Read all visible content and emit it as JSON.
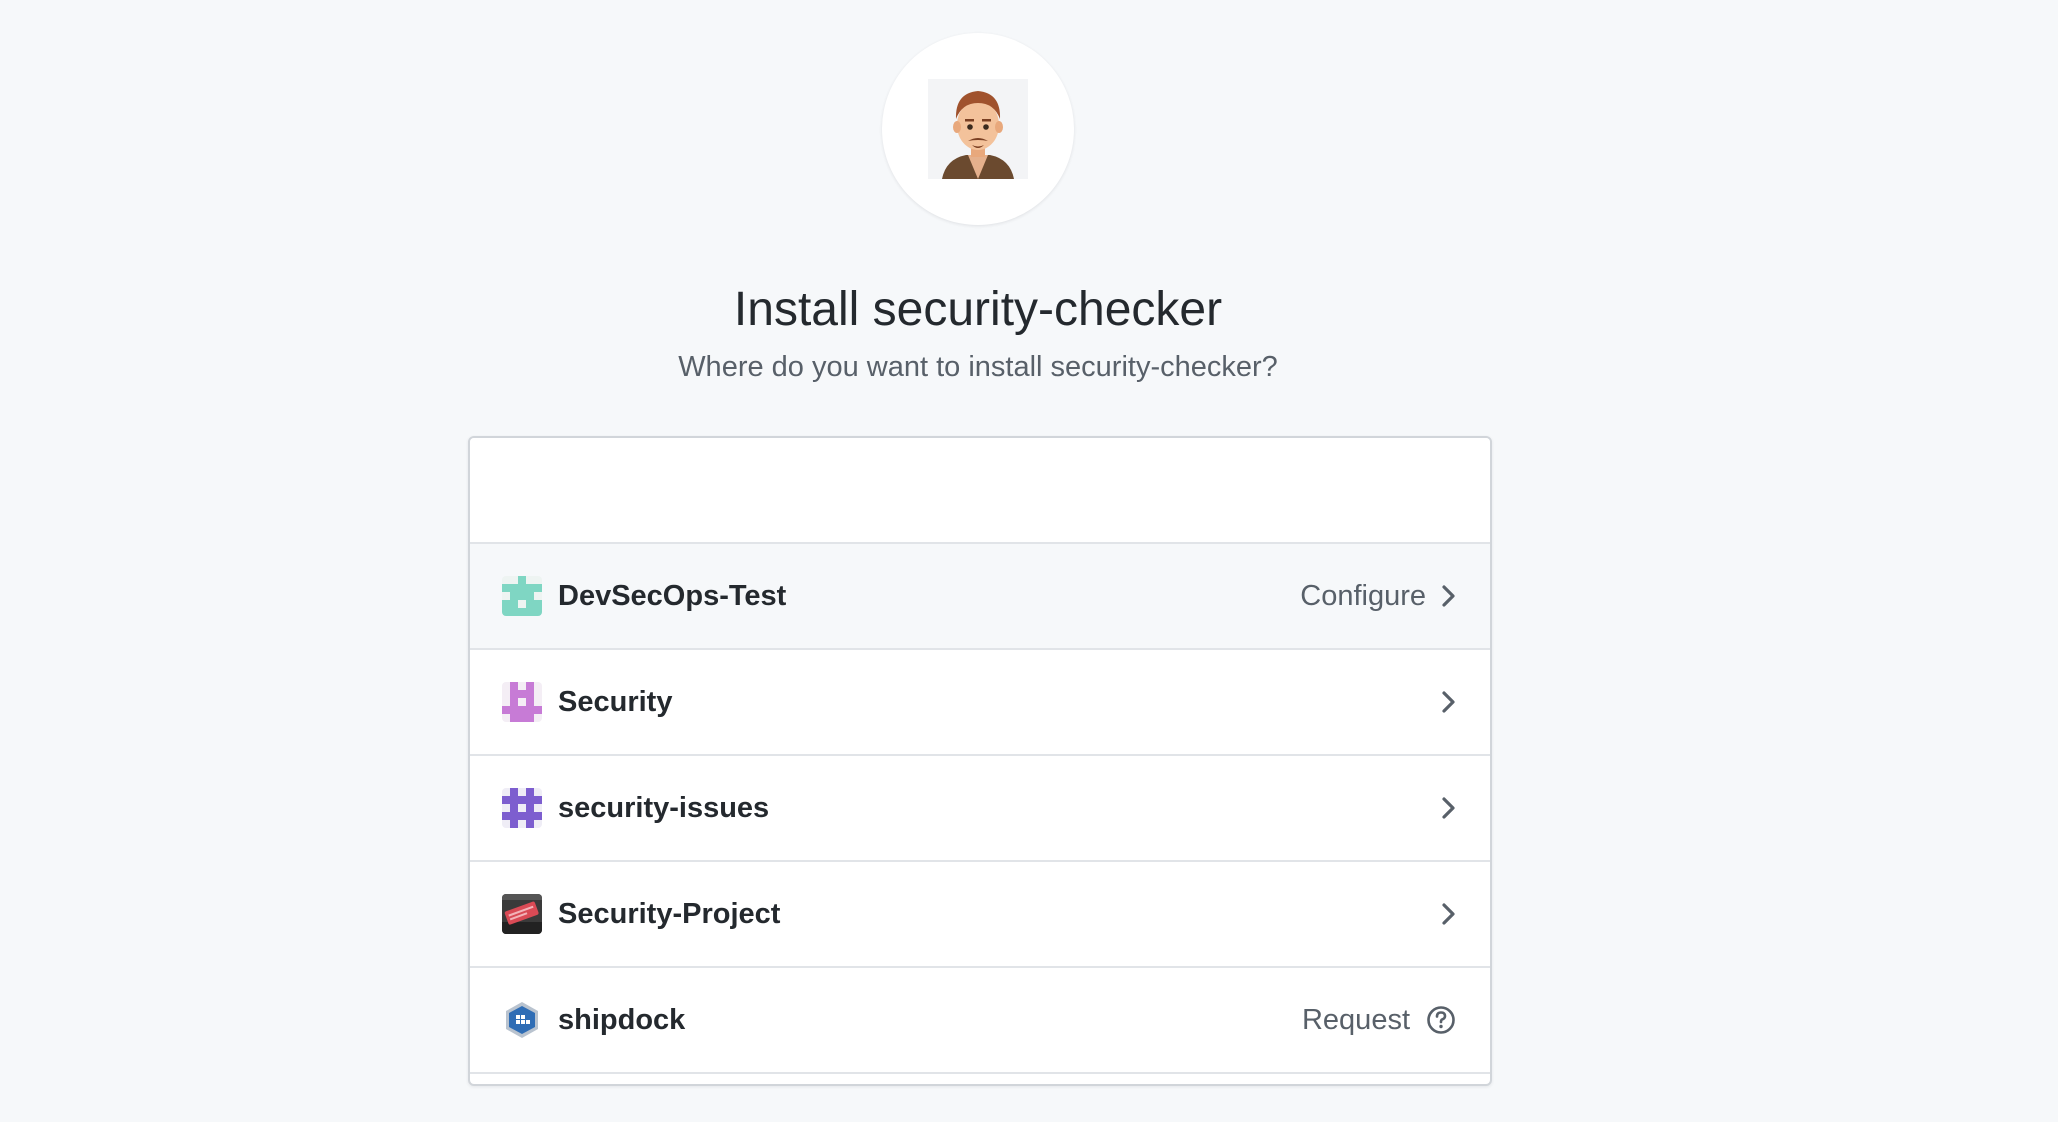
{
  "header": {
    "title": "Install security-checker",
    "subtitle": "Where do you want to install security-checker?"
  },
  "avatar": {
    "icon": "user-avatar-icon"
  },
  "organizations": [
    {
      "name": "DevSecOps-Test",
      "action_label": "Configure",
      "action_icon": "chevron-right-icon",
      "icon": "identicon-teal",
      "color": "#7fd6c3",
      "highlighted": true
    },
    {
      "name": "Security",
      "action_label": "",
      "action_icon": "chevron-right-icon",
      "icon": "identicon-pink",
      "color": "#c77bd6",
      "highlighted": false
    },
    {
      "name": "security-issues",
      "action_label": "",
      "action_icon": "chevron-right-icon",
      "icon": "identicon-purple",
      "color": "#7d5ecf",
      "highlighted": false
    },
    {
      "name": "Security-Project",
      "action_label": "",
      "action_icon": "chevron-right-icon",
      "icon": "project-photo-icon",
      "color": "#d94a55",
      "highlighted": false
    },
    {
      "name": "shipdock",
      "action_label": "Request",
      "action_icon": "question-circle-icon",
      "icon": "shipdock-logo-icon",
      "color": "#2f6db5",
      "highlighted": false
    }
  ],
  "colors": {
    "background": "#f6f8fa",
    "text": "#24292e",
    "muted": "#586069",
    "border": "#e1e4e8"
  }
}
